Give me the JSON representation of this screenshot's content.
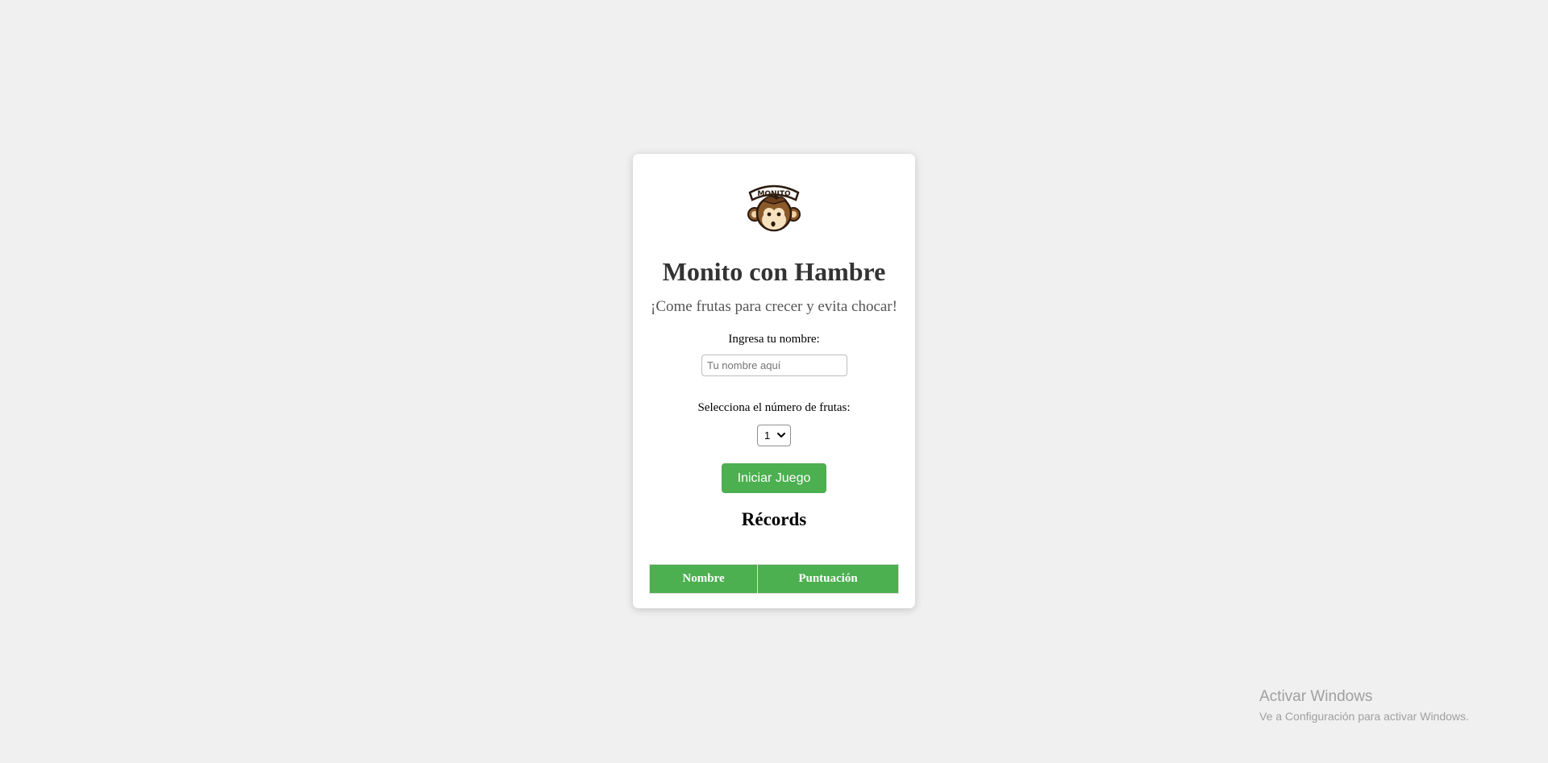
{
  "app": {
    "logo_text": "MONITO",
    "title": "Monito con Hambre",
    "subtitle": "¡Come frutas para crecer y evita chocar!"
  },
  "form": {
    "name_label": "Ingresa tu nombre:",
    "name_value": "",
    "name_placeholder": "Tu nombre aquí",
    "fruits_label": "Selecciona el número de frutas:",
    "fruits_selected": "1",
    "start_button_label": "Iniciar Juego"
  },
  "records": {
    "title": "Récords",
    "columns": [
      "Nombre",
      "Puntuación"
    ],
    "rows": []
  },
  "watermark": {
    "title": "Activar Windows",
    "subtitle": "Ve a Configuración para activar Windows."
  },
  "colors": {
    "accent": "#4caf50",
    "background": "#f0f0f0",
    "card": "#ffffff"
  },
  "icons": {
    "logo": "monkey-logo-icon",
    "select_arrow": "chevron-down-icon"
  }
}
